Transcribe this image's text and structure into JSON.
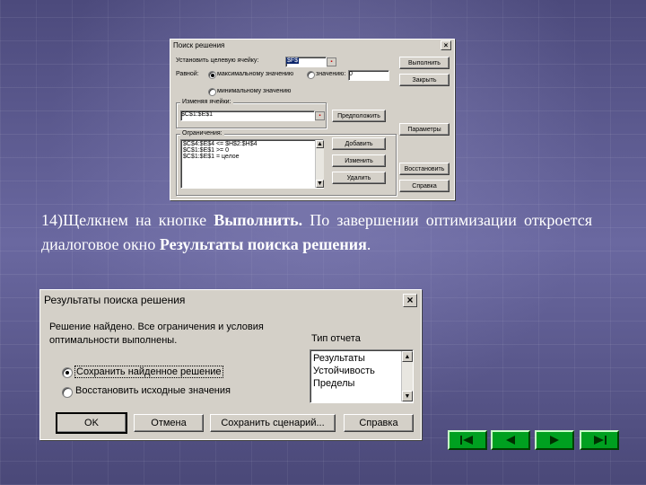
{
  "solver_dialog": {
    "title": "Поиск решения",
    "close_glyph": "×",
    "target_cell_label": "Установить целевую ячейку:",
    "target_cell_value": "$F$",
    "equal_to_label": "Равной:",
    "radio_max": "максимальному значению",
    "radio_value": "значению:",
    "value_field": "0",
    "radio_min": "минимальному значению",
    "changing_cells_label": "Изменяя ячейки:",
    "changing_cells_value": "$C$1:$E$1",
    "guess_button": "Предположить",
    "constraints_label": "Ограничения:",
    "constraints": [
      "$C$4:$E$4 <= $H$2:$H$4",
      "$C$1:$E$1 >= 0",
      "$C$1:$E$1 = целое"
    ],
    "add_button": "Добавить",
    "change_button": "Изменить",
    "delete_button": "Удалить",
    "run_button": "Выполнить",
    "close_button": "Закрыть",
    "params_button": "Параметры",
    "restore_button": "Восстановить",
    "help_button": "Справка"
  },
  "instruction": {
    "number": "14)",
    "part1": "Щелкнем на кнопке ",
    "bold1": "Выполнить.",
    "part2": " По завершении оптимизации откроется диалоговое окно ",
    "bold2": "Результаты поиска решения",
    "part3": "."
  },
  "results_dialog": {
    "title": "Результаты поиска решения",
    "close_glyph": "×",
    "message": "Решение найдено. Все ограничения и условия оптимальности выполнены.",
    "report_type_label": "Тип отчета",
    "reports": [
      "Результаты",
      "Устойчивость",
      "Пределы"
    ],
    "radio_save": "Сохранить найденное решение",
    "radio_restore": "Восстановить исходные значения",
    "ok_button": "OK",
    "cancel_button": "Отмена",
    "save_scenario_button": "Сохранить сценарий...",
    "help_button": "Справка"
  },
  "navigation": {
    "accent_color": "#00a020"
  }
}
